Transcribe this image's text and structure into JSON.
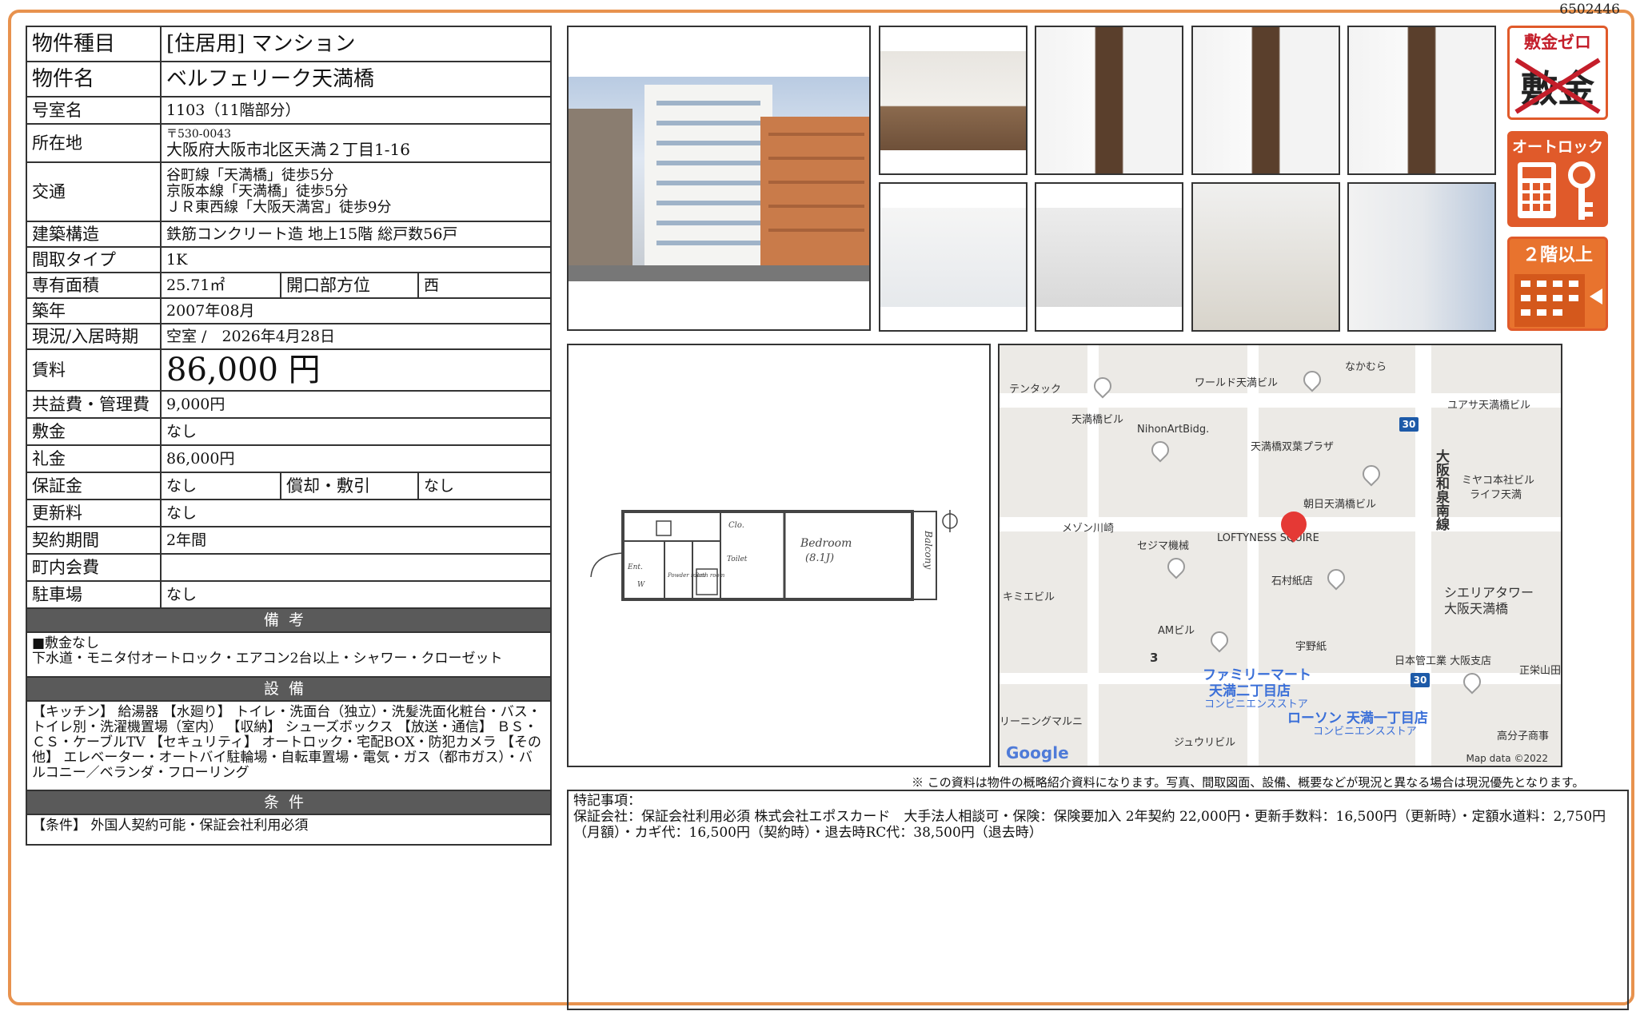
{
  "doc_number": "6502446",
  "property": {
    "type_label": "物件種目",
    "type_value": "[住居用] マンション",
    "name_label": "物件名",
    "name_value": "ベルフェリーク天満橋",
    "room_label": "号室名",
    "room_value": "1103（11階部分）",
    "address_label": "所在地",
    "zip": "〒530-0043",
    "address": "大阪府大阪市北区天満２丁目1-16",
    "transport_label": "交通",
    "transport": [
      "谷町線「天満橋」徒歩5分",
      "京阪本線「天満橋」徒歩5分",
      "ＪＲ東西線「大阪天満宮」徒歩9分"
    ],
    "structure_label": "建築構造",
    "structure_value": "鉄筋コンクリート造 地上15階 総戸数56戸",
    "layout_label": "間取タイプ",
    "layout_value": "1K",
    "area_label": "専有面積",
    "area_value": "25.71㎡",
    "direction_label": "開口部方位",
    "direction_value": "西",
    "built_label": "築年",
    "built_value": "2007年08月",
    "status_label": "現況/入居時期",
    "status_value": "空室 /　2026年4月28日",
    "rent_label": "賃料",
    "rent_value": "86,000 円",
    "fee_label": "共益費・管理費",
    "fee_value": "9,000円",
    "deposit_label": "敷金",
    "deposit_value": "なし",
    "key_money_label": "礼金",
    "key_money_value": "86,000円",
    "guarantee_label": "保証金",
    "guarantee_value": "なし",
    "amort_label": "償却・敷引",
    "amort_value": "なし",
    "renewal_label": "更新料",
    "renewal_value": "なし",
    "contract_label": "契約期間",
    "contract_value": "2年間",
    "community_label": "町内会費",
    "community_value": "",
    "parking_label": "駐車場",
    "parking_value": "なし"
  },
  "sections": {
    "remarks_title": "備考",
    "remarks_lines": [
      "■敷金なし",
      "下水道・モニタ付オートロック・エアコン2台以上・シャワー・クローゼット"
    ],
    "facilities_title": "設備",
    "facilities_text": "【キッチン】 給湯器 【水廻り】 トイレ・洗面台（独立）・洗髪洗面化粧台・バス・トイレ別・洗濯機置場（室内） 【収納】 シューズボックス 【放送・通信】 ＢＳ・ＣＳ・ケーブルTV 【セキュリティ】 オートロック・宅配BOX・防犯カメラ 【その他】 エレベーター・オートバイ駐輪場・自転車置場・電気・ガス（都市ガス）・バルコニー／ベランダ・フローリング",
    "conditions_title": "条件",
    "conditions_text": "【条件】 外国人契約可能・保証会社利用必須"
  },
  "badges": {
    "zero_deposit": "敷金ゼロ",
    "zero_deposit_art": "敷金",
    "autolock": "オートロック",
    "second_floor": "２階以上"
  },
  "floorplan": {
    "bedroom": "Bedroom",
    "bedroom_size": "(8.1J)",
    "balcony": "Balcony",
    "closet": "Clo.",
    "entrance": "Ent.",
    "powder": "Powder room",
    "bath": "Bath room",
    "toilet": "Toilet",
    "washer": "W"
  },
  "map": {
    "labels": [
      "テンタック",
      "ワールド天満ビル",
      "なかむら",
      "ユアサ天満橋ビル",
      "天満橋ビル",
      "NihonArtBidg.",
      "天満橋双葉プラザ",
      "ミヤコ本社ビル",
      "ライフ天満",
      "朝日天満橋ビル",
      "メゾン川崎",
      "セジマ機械",
      "LOFTYNESS SQUIRE",
      "石村紙店",
      "キミエビル",
      "シエリアタワー",
      "大阪天満橋",
      "AMビル",
      "宇野紙",
      "日本管工業 大阪支店",
      "正栄山田",
      "3",
      "リーニングマルニ",
      "ジュウリビル",
      "高分子商事",
      "大阪和泉南線"
    ],
    "stores": [
      "ファミリーマート",
      "天満二丁目店",
      "コンビニエンスストア",
      "ローソン 天満一丁目店",
      "コンビニエンスストア"
    ],
    "route_numbers": [
      "30",
      "30"
    ],
    "google": "Google",
    "map_data": "Map data ©2022"
  },
  "notice": "※ この資料は物件の概略紹介資料になります。写真、間取図面、設備、概要などが現況と異なる場合は現況優先となります。",
  "special": {
    "title": "特記事項：",
    "text": "保証会社：保証会社利用必須 株式会社エポスカード　大手法人相談可・保険：保険要加入 2年契約 22,000円・更新手数料：16,500円（更新時）・定額水道料：2,750円（月額）・カギ代：16,500円（契約時）・退去時RC代：38,500円（退去時）"
  }
}
